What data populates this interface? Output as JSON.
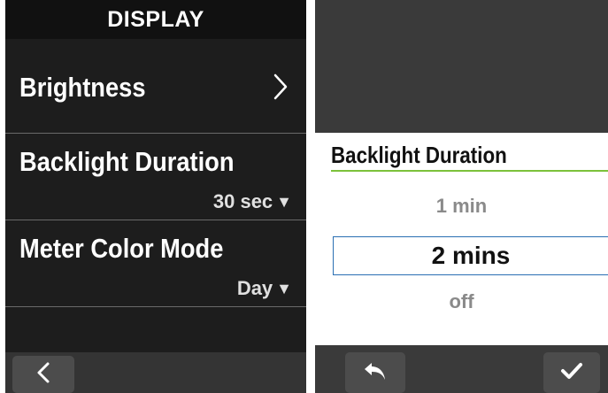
{
  "left_screen": {
    "header": {
      "title": "DISPLAY"
    },
    "menu": [
      {
        "label": "Brightness",
        "icon": "chevron-right-icon"
      },
      {
        "label": "Backlight Duration",
        "value": "30 sec",
        "indicator": "▼"
      },
      {
        "label": "Meter Color Mode",
        "value": "Day",
        "indicator": "▼"
      }
    ],
    "footer": {
      "back_icon": "chevron-left-icon"
    }
  },
  "right_screen": {
    "picker": {
      "title": "Backlight Duration",
      "options": [
        "1 min",
        "2 mins",
        "off"
      ],
      "selected": "2 mins"
    },
    "footer": {
      "undo_icon": "undo-arrow-icon",
      "confirm_icon": "checkmark-icon"
    }
  },
  "colors": {
    "dark_bg": "#1d1d1d",
    "header_bg": "#111111",
    "accent_green": "#7cc13a",
    "selection_border": "#2a6fb3"
  }
}
